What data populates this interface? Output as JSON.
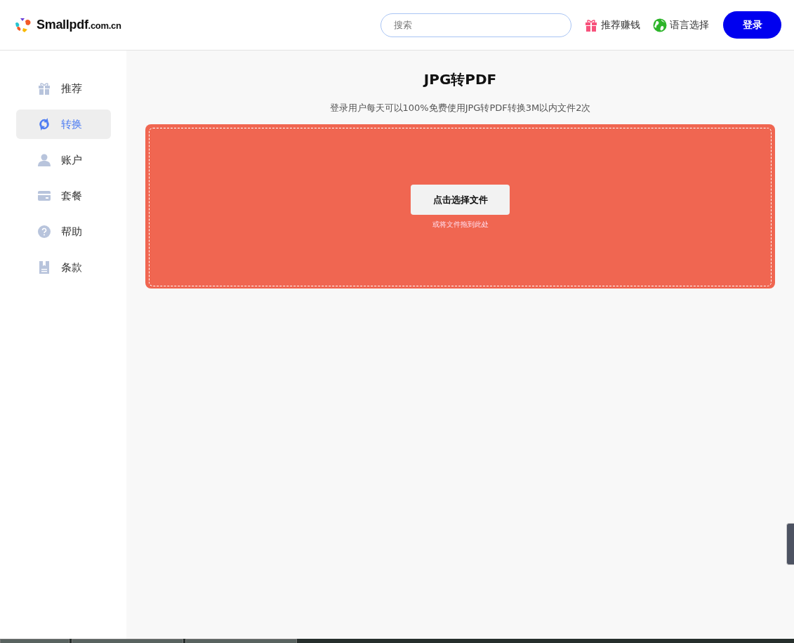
{
  "header": {
    "logo": "Smallpdf",
    "logo_suffix": ".com.cn",
    "search": {
      "placeholder": "搜索"
    },
    "links": [
      {
        "kind": "gift",
        "label": "推荐赚钱"
      },
      {
        "kind": "globe",
        "label": "语言选择"
      }
    ],
    "login": "登录"
  },
  "sidebar": {
    "items": [
      {
        "kind": "gift",
        "label": "推荐",
        "selected": false
      },
      {
        "kind": "convert",
        "label": "转换",
        "selected": true
      },
      {
        "kind": "user",
        "label": "账户",
        "selected": false
      },
      {
        "kind": "card",
        "label": "套餐",
        "selected": false
      },
      {
        "kind": "help",
        "label": "帮助",
        "selected": false
      },
      {
        "kind": "doc",
        "label": "条款",
        "selected": false
      }
    ]
  },
  "main": {
    "title": "JPG转PDF",
    "subtitle": "登录用户每天可以100%免费使用JPG转PDF转换3M以内文件2次",
    "dropzone": {
      "button": "点击选择文件",
      "hint": "或将文件拖到此处"
    }
  }
}
